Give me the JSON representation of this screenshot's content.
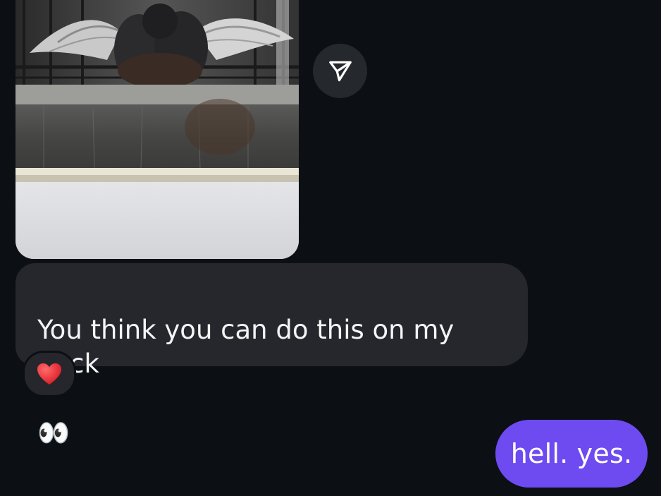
{
  "thread": {
    "shared_photo": {
      "icon": "photo-of-pigeons-statue"
    },
    "share_button": {
      "icon": "paper-plane-icon"
    },
    "incoming_message": {
      "text": "You think you can do this on my back",
      "emoji": "👀"
    },
    "reaction": {
      "emoji": "❤️"
    },
    "outgoing_message": {
      "text": "hell. yes."
    }
  },
  "colors": {
    "background": "#0c0f14",
    "incoming_bubble": "#25272d",
    "outgoing_bubble": "#6d4bf0",
    "share_button_bg": "#25282d"
  }
}
